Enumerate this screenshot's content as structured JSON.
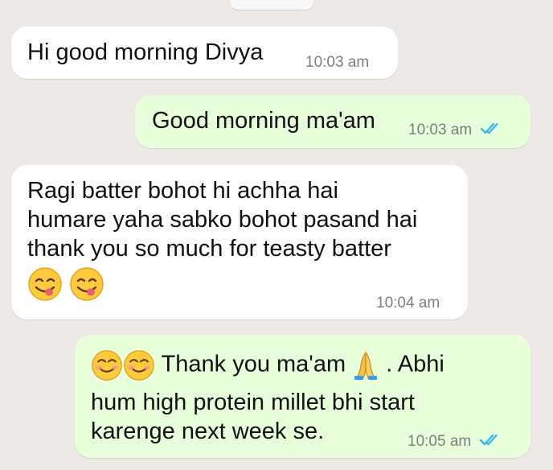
{
  "accent": {
    "incoming_bg": "#ffffff",
    "outgoing_bg": "#e7ffdb",
    "chat_bg": "#ece9e6",
    "read_tick": "#34b7f1"
  },
  "messages": [
    {
      "direction": "incoming",
      "text": "Hi good morning Divya",
      "time": "10:03 am"
    },
    {
      "direction": "outgoing",
      "text": "Good morning ma'am",
      "time": "10:03 am",
      "status": "read"
    },
    {
      "direction": "incoming",
      "lines": [
        "Ragi batter bohot hi achha hai",
        "humare yaha sabko bohot pasand hai",
        "thank you so much for teasty batter"
      ],
      "emojis": [
        "face-savoring-food-emoji",
        "face-savoring-food-emoji"
      ],
      "time": "10:04 am"
    },
    {
      "direction": "outgoing",
      "lead_emojis": [
        "smiling-face-with-smiling-eyes-emoji",
        "smiling-face-with-smiling-eyes-emoji"
      ],
      "text_before_emoji": "Thank you ma'am",
      "mid_emoji": "folded-hands-emoji",
      "text_after_emoji": ". Abhi",
      "lines": [
        "hum high protein millet bhi start",
        "karenge next week se."
      ],
      "time": "10:05 am",
      "status": "read"
    }
  ]
}
